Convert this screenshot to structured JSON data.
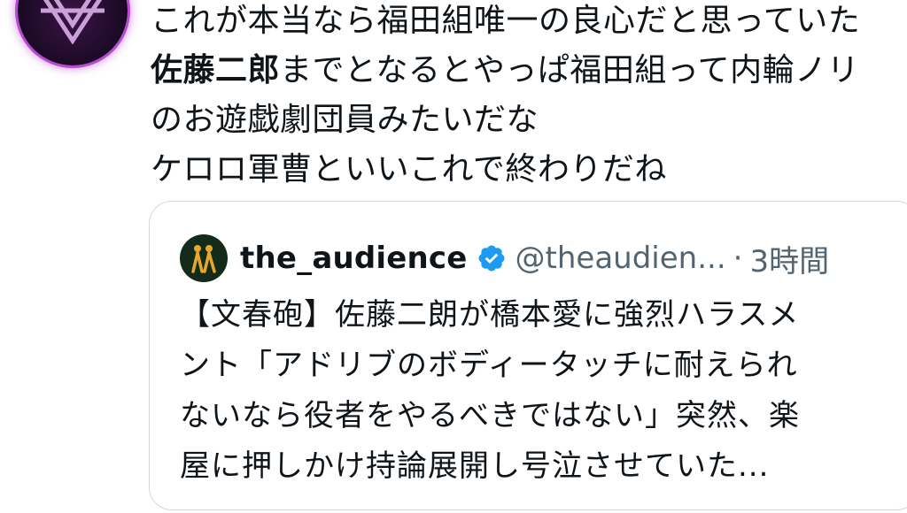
{
  "tweet": {
    "lines": [
      "これが本当なら福田組唯一の良心だと思っていた",
      "佐藤二郎",
      "までとなるとやっぱ福田組って内輪ノリ",
      "のお遊戯劇団員みたいだな",
      "ケロロ軍曹といいこれで終わりだね"
    ]
  },
  "quote": {
    "name": "the_audience",
    "handle": "@theaudien...",
    "separator": "·",
    "time": "3時間",
    "body_lines": [
      "【文春砲】佐藤二朗が橋本愛に強烈ハラスメ",
      "ント「アドリブのボディータッチに耐えられ",
      "ないなら役者をやるべきではない」突然、楽",
      "屋に押しかけ持論展開し号泣させていた..."
    ]
  },
  "icons": {
    "author_avatar": "avatar-icon",
    "quote_avatar": "the-audience-logo-icon",
    "verified": "verified-badge-icon"
  },
  "colors": {
    "text": "#0f1419",
    "muted": "#536471",
    "verified": "#1d9bf0",
    "card_border": "#cfd9de",
    "avatar_glow": "#b74ad6"
  }
}
